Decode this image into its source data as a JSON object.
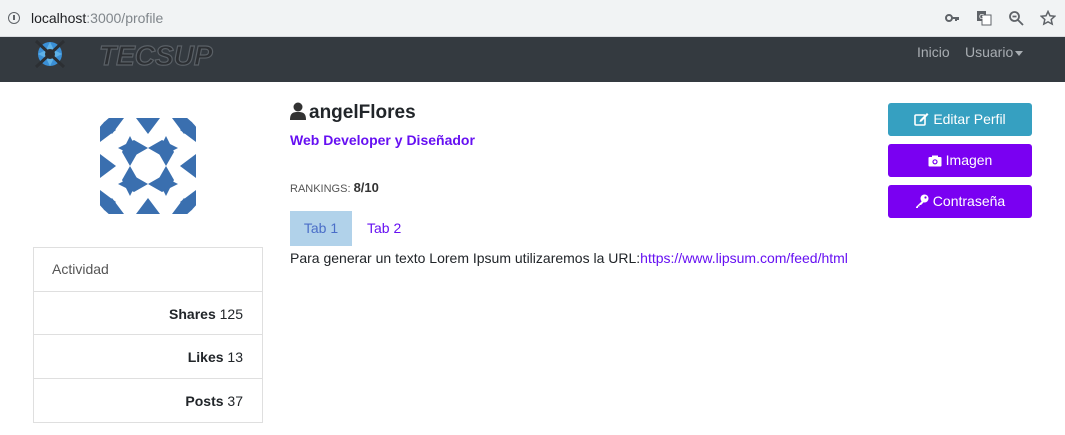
{
  "browser": {
    "url_host": "localhost",
    "url_path": ":3000/profile"
  },
  "nav": {
    "brand": "TECSUP",
    "links": [
      "Inicio",
      "Usuario"
    ]
  },
  "activity": {
    "header": "Actividad",
    "items": [
      {
        "label": "Shares",
        "value": "125"
      },
      {
        "label": "Likes",
        "value": "13"
      },
      {
        "label": "Posts",
        "value": "37"
      }
    ]
  },
  "profile": {
    "username": "angelFlores",
    "role": "Web Developer y Diseñador",
    "rankings_label": "RANKINGS:",
    "rankings_value": "8/10",
    "tabs": [
      "Tab 1",
      "Tab 2"
    ],
    "content_text": "Para generar un texto Lorem Ipsum utilizaremos la URL:",
    "content_link": "https://www.lipsum.com/feed/html"
  },
  "actions": {
    "edit": "Editar Perfil",
    "image": "Imagen",
    "password": "Contraseña"
  },
  "colors": {
    "navbar": "#343a40",
    "accent": "#6610f2",
    "info": "#36a0c1",
    "purple": "#7a00f2"
  }
}
